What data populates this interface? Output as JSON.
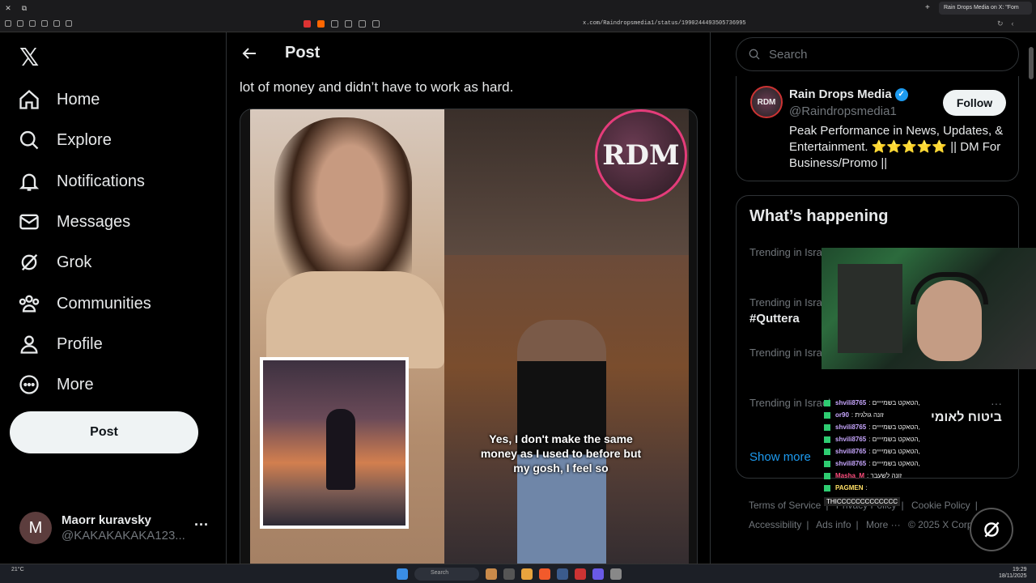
{
  "browser": {
    "tab_title": "Rain Drops Media on X: \"Fom",
    "url": "x.com/Raindropsmedia1/status/1990244493505736995"
  },
  "sidebar": {
    "nav": [
      {
        "label": "Home",
        "icon": "home-icon"
      },
      {
        "label": "Explore",
        "icon": "search-icon"
      },
      {
        "label": "Notifications",
        "icon": "bell-icon"
      },
      {
        "label": "Messages",
        "icon": "mail-icon"
      },
      {
        "label": "Grok",
        "icon": "grok-icon"
      },
      {
        "label": "Communities",
        "icon": "communities-icon"
      },
      {
        "label": "Profile",
        "icon": "person-icon"
      },
      {
        "label": "More",
        "icon": "more-circle-icon"
      }
    ],
    "post_button": "Post",
    "account": {
      "avatar_letter": "M",
      "name": "Maorr kuravsky",
      "handle": "@KAKAKAKAKA123..."
    }
  },
  "main": {
    "header_title": "Post",
    "post_text": "lot of money and didn’t have to work as hard.",
    "media_caption": "Yes, I don't make the same money as I used to before but my gosh, I feel so",
    "media_logo": "RDM"
  },
  "right": {
    "search_placeholder": "Search",
    "profile": {
      "name": "Rain Drops Media",
      "handle": "@Raindropsmedia1",
      "bio": "Peak Performance in News, Updates, & Entertainment. ⭐⭐⭐⭐⭐ || DM For Business/Promo ||",
      "follow_label": "Follow",
      "avatar_text": "RDM"
    },
    "happening": {
      "title": "What’s happening",
      "trends": [
        {
          "context": "Trending in Israel",
          "name": ""
        },
        {
          "context": "Trending in Israel",
          "name": "#Quttera"
        },
        {
          "context": "Trending in Israel",
          "name": ""
        },
        {
          "context": "Trending in Israel",
          "name": ""
        }
      ],
      "show_more": "Show more"
    },
    "footer": {
      "links": [
        "Terms of Service",
        "|",
        "Privacy Policy",
        "|",
        "Cookie Policy",
        "|",
        "Accessibility",
        "|",
        "Ads info",
        "|",
        "More ···",
        "© 2025 X Corp."
      ]
    }
  },
  "overlay": {
    "hebrew_trend": "ביטוח לאומי",
    "chat": [
      {
        "user": "shvili8765",
        "msg": ": הטאקט בשמיייים,",
        "color": "purple"
      },
      {
        "user": "or90",
        "msg": ": זונה גולגית",
        "color": "purple"
      },
      {
        "user": "shvili8765",
        "msg": ": הטאקט בשמיייים,",
        "color": "purple"
      },
      {
        "user": "shvili8765",
        "msg": ": הטאקט בשמיייים,",
        "color": "purple"
      },
      {
        "user": "shvili8765",
        "msg": ": הטאקט בשמיייים,",
        "color": "purple"
      },
      {
        "user": "shvili8765",
        "msg": ": הטאקט בשמיייים,",
        "color": "purple"
      },
      {
        "user": "Masha_M",
        "msg": ": זונה לשעבר",
        "color": "pink"
      },
      {
        "user": "PAGMEN",
        "msg": ":",
        "color": "yellow"
      }
    ],
    "chat_last": "THICCCCCCCCCCCCC"
  },
  "taskbar": {
    "weather_temp": "21°C",
    "search_label": "Search",
    "time": "19:29",
    "date": "18/11/2025"
  }
}
